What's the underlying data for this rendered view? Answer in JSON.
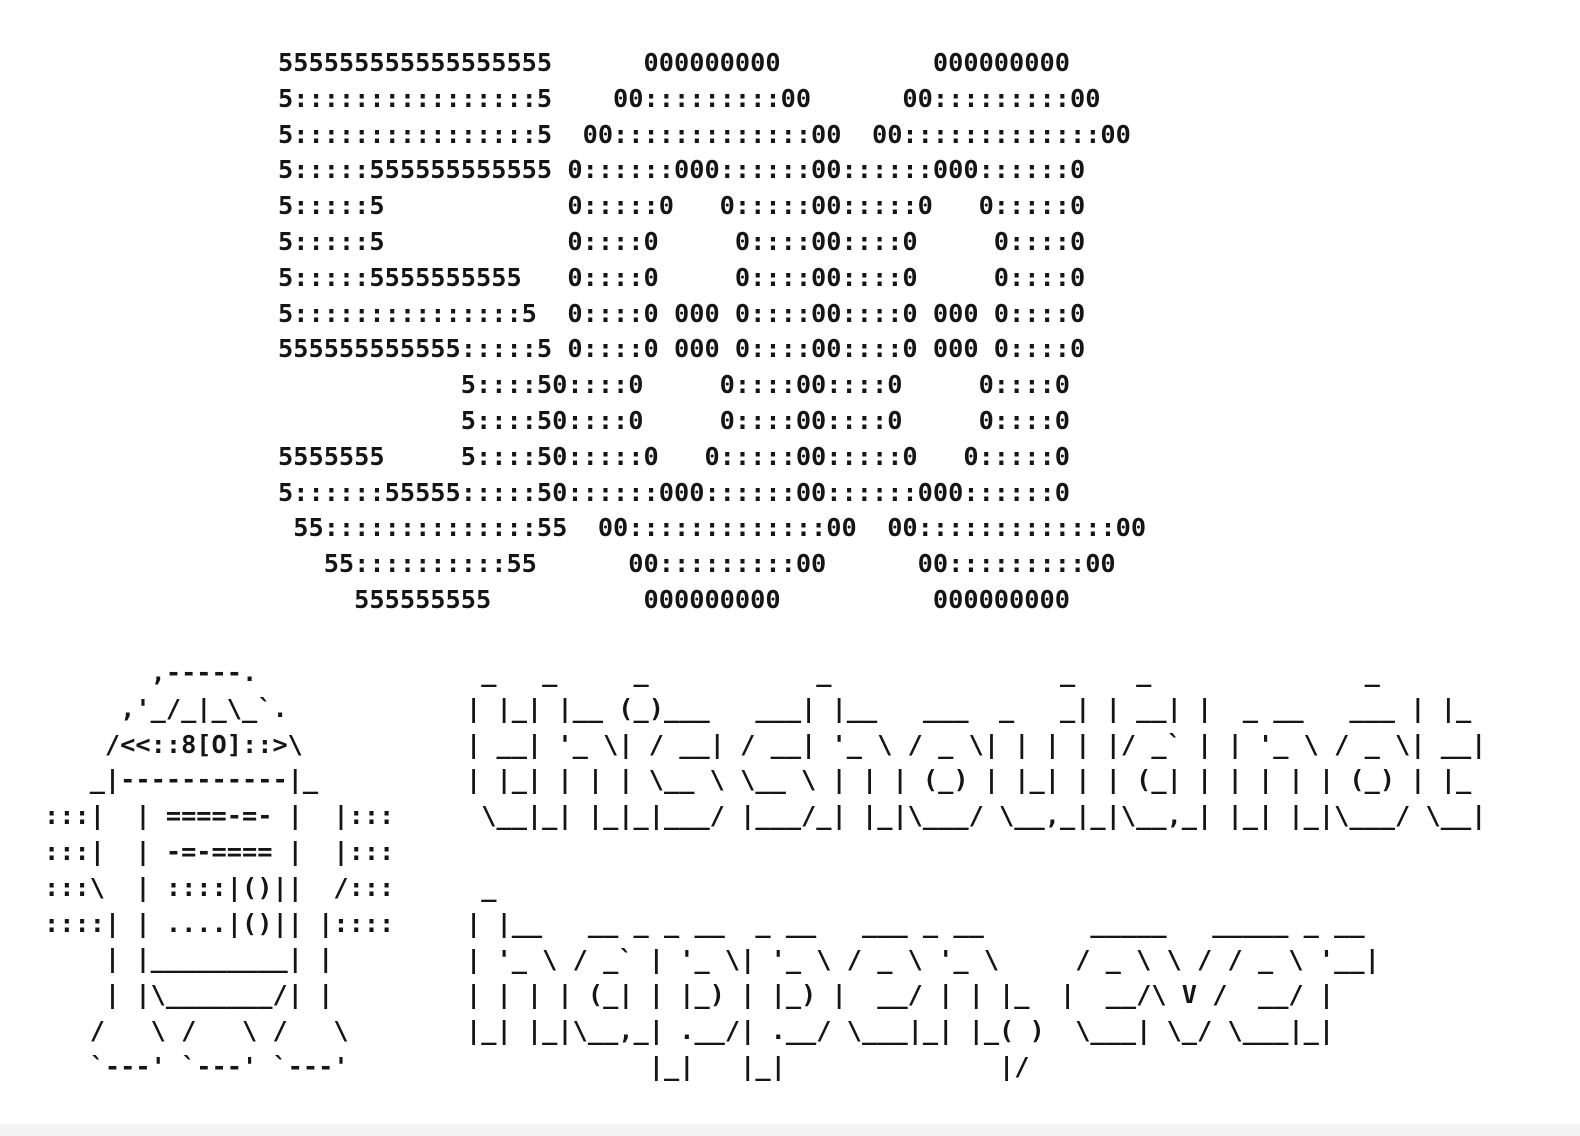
{
  "error_code_art": [
    "555555555555555555      000000000          000000000",
    "5::::::::::::::::5    00:::::::::00      00:::::::::00",
    "5::::::::::::::::5  00:::::::::::::00  00:::::::::::::00",
    "5:::::555555555555 0::::::000::::::00::::::000::::::0",
    "5:::::5            0:::::0   0:::::00:::::0   0:::::0",
    "5:::::5            0::::0     0::::00::::0     0::::0",
    "5:::::5555555555   0::::0     0::::00::::0     0::::0",
    "5:::::::::::::::5  0::::0 000 0::::00::::0 000 0::::0",
    "555555555555:::::5 0::::0 000 0::::00::::0 000 0::::0",
    "            5::::50::::0     0::::00::::0     0::::0",
    "            5::::50::::0     0::::00::::0     0::::0",
    "5555555     5::::50:::::0   0:::::00:::::0   0:::::0",
    "5::::::55555:::::50::::::000::::::00::::::000::::::0",
    " 55::::::::::::::55  00:::::::::::::00  00:::::::::::::00",
    "   55::::::::::55      00:::::::::00      00:::::::::00",
    "     555555555          000000000          000000000"
  ],
  "robot_art": [
    "       ,-----.",
    "     ,'_/_|_\\_`.",
    "    /<<::8[O]::>\\",
    "   _|-----------|_",
    ":::|  | ====-=- |  |:::",
    ":::|  | -=-==== |  |:::",
    ":::\\  | ::::|()||  /:::",
    "::::| | ....|()|| |::::",
    "    | |_________| |",
    "    | |\\_______/| |",
    "   /   \\ /   \\ /   \\",
    "   `---' `---' `---'"
  ],
  "message_line_1_art": [
    " _   _     _           _               _    _              _",
    "| |_| |__ (_)___   ___| |__   ___  _   _| | __| |  _ __   ___ | |_",
    "| __| '_ \\| / __| / __| '_ \\ / _ \\| | | | |/ _` | | '_ \\ / _ \\| __|",
    "| |_| | | | \\__ \\ \\__ \\ | | | (_) | |_| | | (_| | | | | | (_) | |_",
    " \\__|_| |_|_|___/ |___/_| |_|\\___/ \\__,_|_|\\__,_| |_| |_|\\___/ \\__|"
  ],
  "message_line_2_art": [
    " _",
    "| |__   __ _ _ __  _ __   ___ _ __       _____   _____ _ __",
    "| '_ \\ / _` | '_ \\| '_ \\ / _ \\ '_ \\     / _ \\ \\ / / _ \\ '__|",
    "| | | | (_| | |_) | |_) |  __/ | | |_  |  __/\\ V /  __/ |",
    "|_| |_|\\__,_| .__/| .__/ \\___|_| |_( )  \\___| \\_/ \\___|_|",
    "            |_|   |_|              |/"
  ],
  "colors": {
    "background": "#ffffff",
    "text": "#151515",
    "bottom_strip": "#f4f4f5"
  }
}
